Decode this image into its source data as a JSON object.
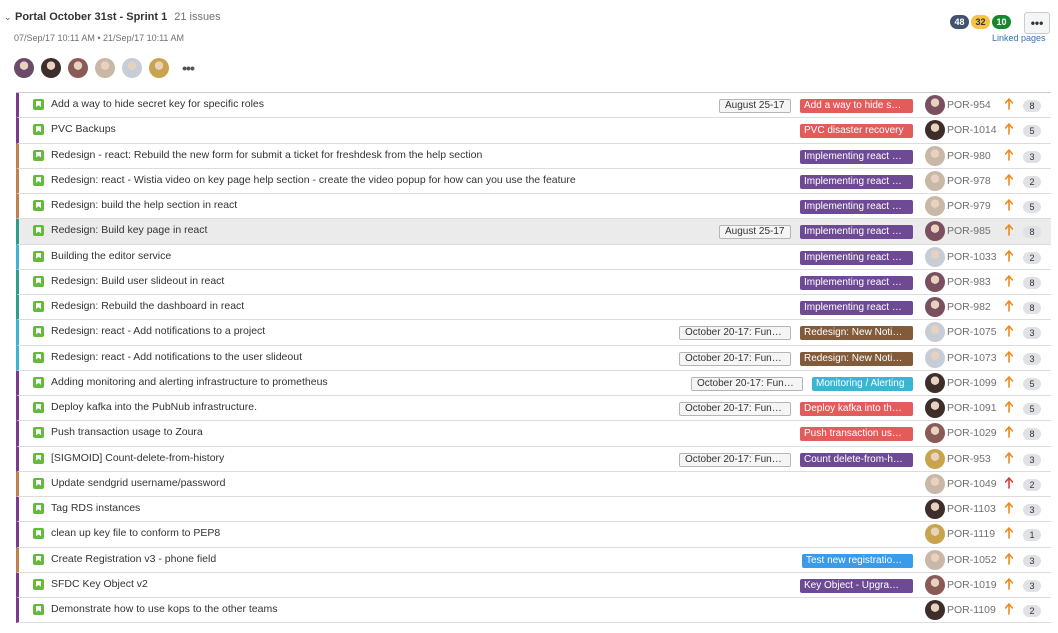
{
  "sprint": {
    "name": "Portal October 31st - Sprint 1",
    "issue_count": "21 issues",
    "dates": "07/Sep/17 10:11 AM • 21/Sep/17 10:11 AM",
    "linked_pages": "Linked pages",
    "more_label": "•••",
    "people_more": "•••",
    "people": [
      {
        "color": "#6b4a6a"
      },
      {
        "color": "#3d2e2b"
      },
      {
        "color": "#8a5a56"
      },
      {
        "color": "#c9b8a8"
      },
      {
        "color": "#c7cdd6"
      },
      {
        "color": "#c9a44d"
      }
    ],
    "counts": [
      {
        "value": "48",
        "bg": "#42526e",
        "fg": "#ffffff"
      },
      {
        "value": "32",
        "bg": "#f6c342",
        "fg": "#333333"
      },
      {
        "value": "10",
        "bg": "#14892c",
        "fg": "#ffffff"
      }
    ]
  },
  "colors": {
    "epic_red": "#e25c5c",
    "epic_purple": "#6e4a95",
    "epic_brown": "#815b3a",
    "epic_teal": "#3fb3d3",
    "epic_blue": "#3b9be8",
    "priority_orange": "#f0891e",
    "priority_red": "#d04437"
  },
  "issues": [
    {
      "summary": "Add a way to hide secret key for specific roles",
      "version": "August 25-17",
      "epic": "Add a way to hide s…",
      "epic_color": "#e25c5c",
      "key": "POR-954",
      "points": "8",
      "priority": "high",
      "border": "#7a3b8f",
      "avatar": "#7a4f5f"
    },
    {
      "summary": "PVC Backups",
      "version": "",
      "epic": "PVC disaster recovery",
      "epic_color": "#e25c5c",
      "key": "POR-1014",
      "points": "5",
      "priority": "high",
      "border": "#7a3b8f",
      "avatar": "#3d2e2b"
    },
    {
      "summary": "Redesign - react: Rebuild the new form for submit a ticket for freshdesk from the help section",
      "version": "",
      "epic": "Implementing react …",
      "epic_color": "#6e4a95",
      "key": "POR-980",
      "points": "3",
      "priority": "high",
      "border": "#c1814f",
      "avatar": "#c9b8a8"
    },
    {
      "summary": "Redesign: react - Wistia video on key page help section - create the video popup for how can you use the feature",
      "version": "",
      "epic": "Implementing react …",
      "epic_color": "#6e4a95",
      "key": "POR-978",
      "points": "2",
      "priority": "high",
      "border": "#c1814f",
      "avatar": "#c9b8a8"
    },
    {
      "summary": "Redesign: build the help section in react",
      "version": "",
      "epic": "Implementing react …",
      "epic_color": "#6e4a95",
      "key": "POR-979",
      "points": "5",
      "priority": "high",
      "border": "#c1814f",
      "avatar": "#c9b8a8"
    },
    {
      "summary": "Redesign: Build key page in react",
      "version": "August 25-17",
      "epic": "Implementing react …",
      "epic_color": "#6e4a95",
      "key": "POR-985",
      "points": "8",
      "priority": "high",
      "border": "#2e9e8a",
      "avatar": "#7a4f5f",
      "selected": true
    },
    {
      "summary": "Building the editor service",
      "version": "",
      "epic": "Implementing react …",
      "epic_color": "#6e4a95",
      "key": "POR-1033",
      "points": "2",
      "priority": "high",
      "border": "#3fb3d3",
      "avatar": "#c7cdd6"
    },
    {
      "summary": "Redesign: Build user slideout in react",
      "version": "",
      "epic": "Implementing react …",
      "epic_color": "#6e4a95",
      "key": "POR-983",
      "points": "8",
      "priority": "high",
      "border": "#2e9e8a",
      "avatar": "#7a4f5f"
    },
    {
      "summary": "Redesign: Rebuild the dashboard in react",
      "version": "",
      "epic": "Implementing react …",
      "epic_color": "#6e4a95",
      "key": "POR-982",
      "points": "8",
      "priority": "high",
      "border": "#2e9e8a",
      "avatar": "#7a4f5f"
    },
    {
      "summary": "Redesign: react - Add notifications to a project",
      "version": "October 20-17: Fun…",
      "epic": "Redesign: New Noti…",
      "epic_color": "#815b3a",
      "key": "POR-1075",
      "points": "3",
      "priority": "high",
      "border": "#3fb3d3",
      "avatar": "#c7cdd6"
    },
    {
      "summary": "Redesign: react - Add notifications to the user slideout",
      "version": "October 20-17: Fun…",
      "epic": "Redesign: New Noti…",
      "epic_color": "#815b3a",
      "key": "POR-1073",
      "points": "3",
      "priority": "high",
      "border": "#3fb3d3",
      "avatar": "#c7cdd6"
    },
    {
      "summary": "Adding monitoring and alerting infrastructure to prometheus",
      "version": "October 20-17: Fun…",
      "epic": "Monitoring / Alerting",
      "epic_color": "#3fb3d3",
      "key": "POR-1099",
      "points": "5",
      "priority": "high",
      "border": "#7a3b8f",
      "avatar": "#3d2e2b"
    },
    {
      "summary": "Deploy kafka into the PubNub infrastructure.",
      "version": "October 20-17: Fun…",
      "epic": "Deploy kafka into th…",
      "epic_color": "#e25c5c",
      "key": "POR-1091",
      "points": "5",
      "priority": "high",
      "border": "#7a3b8f",
      "avatar": "#3d2e2b"
    },
    {
      "summary": "Push transaction usage to Zoura",
      "version": "",
      "epic": "Push transaction us…",
      "epic_color": "#e25c5c",
      "key": "POR-1029",
      "points": "8",
      "priority": "high",
      "border": "#7a3b8f",
      "avatar": "#8a5a56"
    },
    {
      "summary": "[SIGMOID] Count-delete-from-history",
      "version": "October 20-17: Fun…",
      "epic": "Count delete-from-h…",
      "epic_color": "#6e4a95",
      "key": "POR-953",
      "points": "3",
      "priority": "high",
      "border": "#7a3b8f",
      "avatar": "#c9a44d"
    },
    {
      "summary": "Update sendgrid username/password",
      "version": "",
      "epic": "",
      "epic_color": "",
      "key": "POR-1049",
      "points": "2",
      "priority": "highest",
      "border": "#c1814f",
      "avatar": "#c9b8a8"
    },
    {
      "summary": "Tag RDS instances",
      "version": "",
      "epic": "",
      "epic_color": "",
      "key": "POR-1103",
      "points": "3",
      "priority": "high",
      "border": "#7a3b8f",
      "avatar": "#3d2e2b"
    },
    {
      "summary": "clean up key file to conform to PEP8",
      "version": "",
      "epic": "",
      "epic_color": "",
      "key": "POR-1119",
      "points": "1",
      "priority": "high",
      "border": "#7a3b8f",
      "avatar": "#c9a44d"
    },
    {
      "summary": "Create Registration v3 - phone field",
      "version": "",
      "epic": "Test new registratio…",
      "epic_color": "#3b9be8",
      "key": "POR-1052",
      "points": "3",
      "priority": "high",
      "border": "#c1814f",
      "avatar": "#c9b8a8"
    },
    {
      "summary": "SFDC Key Object v2",
      "version": "",
      "epic": "Key Object - Upgra…",
      "epic_color": "#6e4a95",
      "key": "POR-1019",
      "points": "3",
      "priority": "high",
      "border": "#7a3b8f",
      "avatar": "#8a5a56"
    },
    {
      "summary": "Demonstrate how to use kops to the other teams",
      "version": "",
      "epic": "",
      "epic_color": "",
      "key": "POR-1109",
      "points": "2",
      "priority": "high",
      "border": "#7a3b8f",
      "avatar": "#3d2e2b"
    }
  ]
}
